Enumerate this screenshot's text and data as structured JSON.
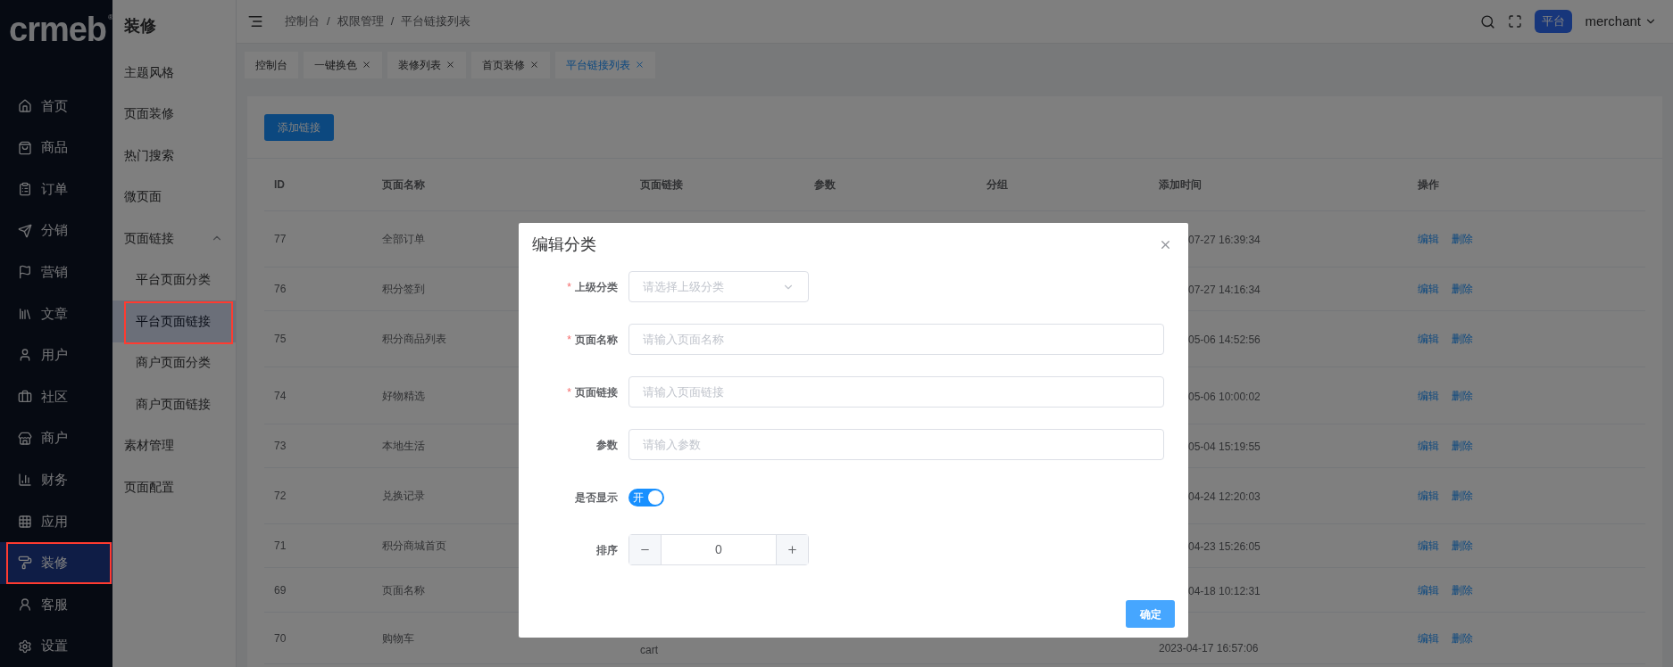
{
  "logo": {
    "text": "crmeb",
    "mark": "®"
  },
  "nav": [
    {
      "label": "首页",
      "selected": false,
      "annotated": false
    },
    {
      "label": "商品",
      "selected": false,
      "annotated": false
    },
    {
      "label": "订单",
      "selected": false,
      "annotated": false
    },
    {
      "label": "分销",
      "selected": false,
      "annotated": false
    },
    {
      "label": "营销",
      "selected": false,
      "annotated": false
    },
    {
      "label": "文章",
      "selected": false,
      "annotated": false
    },
    {
      "label": "用户",
      "selected": false,
      "annotated": false
    },
    {
      "label": "社区",
      "selected": false,
      "annotated": false
    },
    {
      "label": "商户",
      "selected": false,
      "annotated": false
    },
    {
      "label": "财务",
      "selected": false,
      "annotated": false
    },
    {
      "label": "应用",
      "selected": false,
      "annotated": false
    },
    {
      "label": "装修",
      "selected": true,
      "annotated": true
    },
    {
      "label": "客服",
      "selected": false,
      "annotated": false
    },
    {
      "label": "设置",
      "selected": false,
      "annotated": false
    }
  ],
  "submenu": {
    "title": "装修",
    "items": [
      {
        "label": "主题风格",
        "selected": false,
        "annotated": false
      },
      {
        "label": "页面装修",
        "selected": false,
        "annotated": false
      },
      {
        "label": "热门搜索",
        "selected": false,
        "annotated": false
      },
      {
        "label": "微页面",
        "selected": false,
        "annotated": false
      },
      {
        "label": "页面链接",
        "selected": false,
        "annotated": false,
        "expanded": true,
        "children": [
          {
            "label": "平台页面分类",
            "selected": false,
            "annotated": false
          },
          {
            "label": "平台页面链接",
            "selected": true,
            "annotated": true
          },
          {
            "label": "商户页面分类",
            "selected": false,
            "annotated": false
          },
          {
            "label": "商户页面链接",
            "selected": false,
            "annotated": false
          }
        ]
      },
      {
        "label": "素材管理",
        "selected": false,
        "annotated": false
      },
      {
        "label": "页面配置",
        "selected": false,
        "annotated": false
      }
    ]
  },
  "breadcrumb": [
    "控制台",
    "/",
    "权限管理",
    "/",
    "平台链接列表"
  ],
  "header": {
    "badge": "平台",
    "user": "merchant"
  },
  "tabs": [
    {
      "label": "控制台",
      "selected": false,
      "closable": false
    },
    {
      "label": "一键换色",
      "selected": false,
      "closable": true
    },
    {
      "label": "装修列表",
      "selected": false,
      "closable": true
    },
    {
      "label": "首页装修",
      "selected": false,
      "closable": true
    },
    {
      "label": "平台链接列表",
      "selected": true,
      "closable": true
    }
  ],
  "add_button": "添加链接",
  "table": {
    "columns": [
      "ID",
      "页面名称",
      "页面链接",
      "参数",
      "分组",
      "添加时间",
      "操作"
    ],
    "rows": [
      {
        "id": "77",
        "name": "全部订单",
        "time": "07-27 16:39:34",
        "actions": [
          "编辑",
          "删除"
        ]
      },
      {
        "id": "76",
        "name": "积分签到",
        "time": "07-27 14:16:34",
        "actions": [
          "编辑",
          "删除"
        ]
      },
      {
        "id": "75",
        "name": "积分商品列表",
        "time": "05-06 14:52:56",
        "actions": [
          "编辑",
          "删除"
        ]
      },
      {
        "id": "74",
        "name": "好物精选",
        "time": "05-06 10:00:02",
        "actions": [
          "编辑",
          "删除"
        ]
      },
      {
        "id": "73",
        "name": "本地生活",
        "time": "05-04 15:19:55",
        "actions": [
          "编辑",
          "删除"
        ]
      },
      {
        "id": "72",
        "name": "兑换记录",
        "time": "04-24 12:20:03",
        "actions": [
          "编辑",
          "删除"
        ]
      },
      {
        "id": "71",
        "name": "积分商城首页",
        "time": "04-23 15:26:05",
        "actions": [
          "编辑",
          "删除"
        ]
      },
      {
        "id": "69",
        "name": "页面名称",
        "time": "04-18 10:12:31",
        "actions": [
          "编辑",
          "删除"
        ]
      },
      {
        "id": "70",
        "name": "购物车",
        "link": "cart",
        "time": "2023-04-17 16:57:06",
        "actions": [
          "编辑",
          "删除"
        ]
      }
    ]
  },
  "dialog": {
    "title": "编辑分类",
    "fields": [
      {
        "kind": "select",
        "label": "上级分类",
        "required_mark": "*",
        "placeholder": "请选择上级分类"
      },
      {
        "kind": "input",
        "label": "页面名称",
        "required_mark": "*",
        "placeholder": "请输入页面名称"
      },
      {
        "kind": "input",
        "label": "页面链接",
        "required_mark": "*",
        "placeholder": "请输入页面链接"
      },
      {
        "kind": "input",
        "label": "参数",
        "placeholder": "请输入参数"
      },
      {
        "kind": "switch",
        "label": "是否显示",
        "on": true,
        "text": "开"
      },
      {
        "kind": "number",
        "label": "排序",
        "value": "0"
      }
    ],
    "confirm": "确定"
  }
}
